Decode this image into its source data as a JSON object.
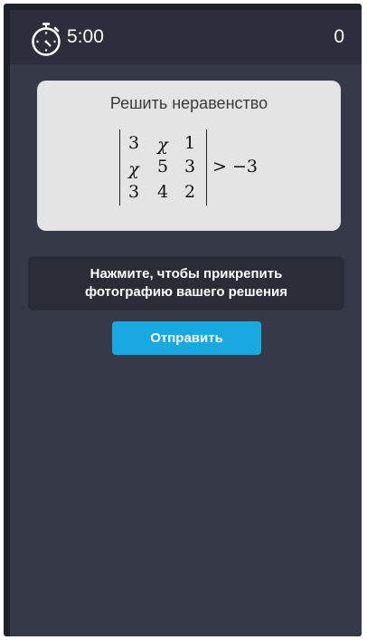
{
  "header": {
    "timer_icon": "stopwatch-icon",
    "timer": "5:00",
    "score": "0"
  },
  "task": {
    "title": "Решить неравенство",
    "matrix": [
      [
        "3",
        "χ",
        "1"
      ],
      [
        "χ",
        "5",
        "3"
      ],
      [
        "3",
        "4",
        "2"
      ]
    ],
    "relation": "> −3"
  },
  "attach": {
    "line1": "Нажмите, чтобы прикрепить",
    "line2": "фотографию вашего решения"
  },
  "submit": {
    "label": "Отправить"
  },
  "colors": {
    "background": "#363a48",
    "topbar": "#2c2f3b",
    "card": "#e4e4e4",
    "attach_panel": "#2a2d38",
    "accent": "#19a8e0"
  }
}
